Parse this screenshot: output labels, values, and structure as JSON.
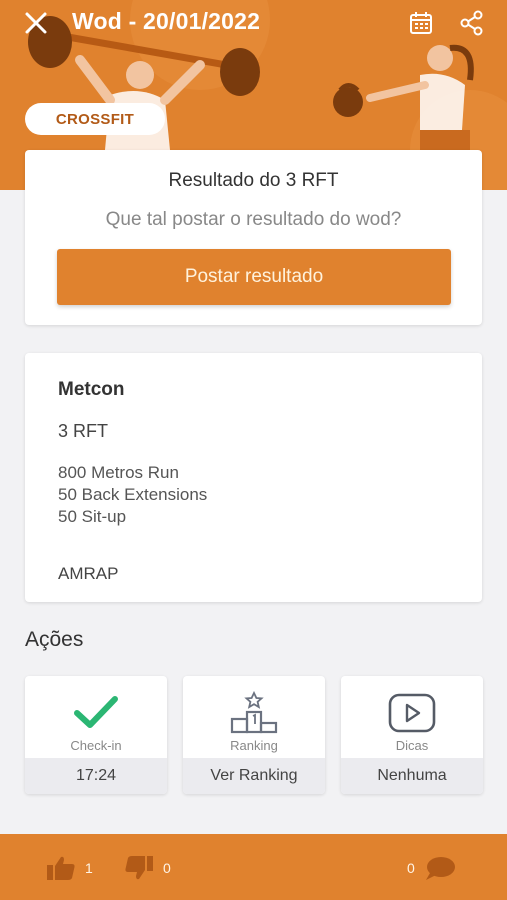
{
  "header": {
    "title": "Wod - 20/01/2022",
    "tag": "CROSSFIT"
  },
  "result_card": {
    "title": "Resultado do 3 RFT",
    "prompt": "Que tal postar o resultado do wod?",
    "button_label": "Postar resultado"
  },
  "metcon": {
    "title": "Metcon",
    "subtitle": "3 RFT",
    "lines": [
      "800 Metros Run",
      "50 Back Extensions",
      "50 Sit-up"
    ],
    "type": "AMRAP"
  },
  "actions": {
    "heading": "Ações",
    "items": [
      {
        "label": "Check-in",
        "value": "17:24",
        "icon": "check-icon"
      },
      {
        "label": "Ranking",
        "value": "Ver Ranking",
        "icon": "podium-icon"
      },
      {
        "label": "Dicas",
        "value": "Nenhuma",
        "icon": "play-icon"
      }
    ]
  },
  "footer": {
    "likes": "1",
    "dislikes": "0",
    "comments": "0"
  },
  "colors": {
    "brand": "#e0822e",
    "check": "#2bb673",
    "footer_icon": "#b25a17"
  }
}
